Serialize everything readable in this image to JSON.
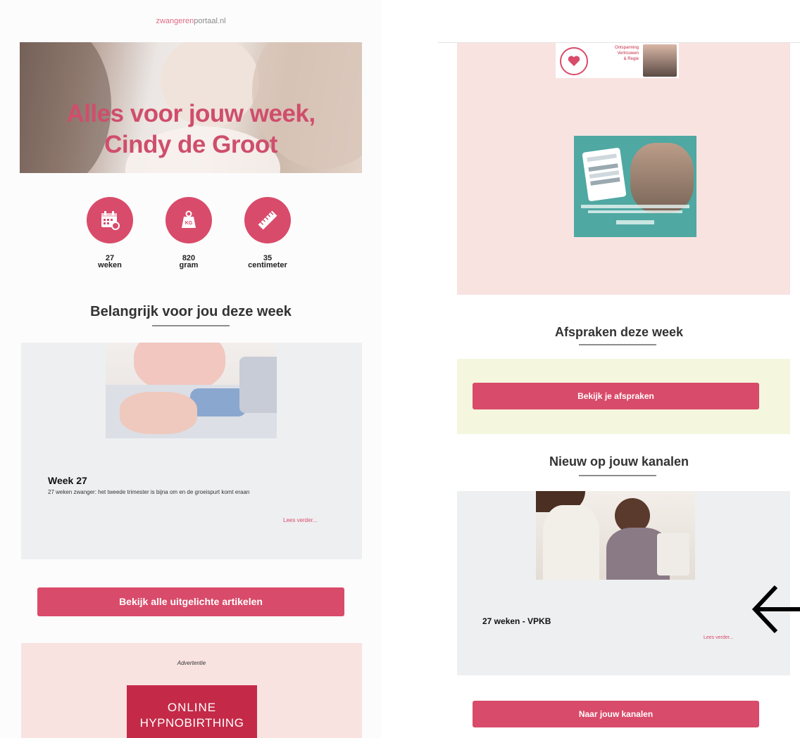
{
  "left": {
    "logo": {
      "part1": "zwangeren",
      "part2": "portaal.nl"
    },
    "hero_title_line1": "Alles voor jouw week,",
    "hero_title_line2": "Cindy de Groot",
    "stats": [
      {
        "icon": "calendar-icon",
        "value": "27",
        "unit": "weken"
      },
      {
        "icon": "weight-icon",
        "value": "820",
        "unit": "gram"
      },
      {
        "icon": "ruler-icon",
        "value": "35",
        "unit": "centimeter"
      }
    ],
    "weight_icon_text": "KG",
    "important_title": "Belangrijk voor jou deze week",
    "article": {
      "title": "Week 27",
      "summary": "27 weken zwanger: het tweede trimester is bijna om en de groeispurt komt eraan",
      "read_more": "Lees verder..."
    },
    "all_articles_button": "Bekijk alle uitgelichte artikelen",
    "ad_label": "Advertentie",
    "ad_banner_line1": "ONLINE",
    "ad_banner_line2": "HYPNOBIRTHING"
  },
  "right": {
    "top_ad_text": [
      "Ontspanning",
      "Vertrouwen",
      "& Regie"
    ],
    "appointments_title": "Afspraken deze week",
    "appointments_button": "Bekijk je afspraken",
    "channels_title": "Nieuw op jouw kanalen",
    "channel_item": {
      "title": "27 weken - VPKB",
      "read_more": "Lees verder..."
    },
    "channels_button": "Naar jouw kanalen"
  },
  "colors": {
    "accent": "#d94b6a",
    "card_bg": "#eeeff1",
    "ad_bg": "#f8e3e1",
    "appointments_bg": "#f4f7de"
  }
}
